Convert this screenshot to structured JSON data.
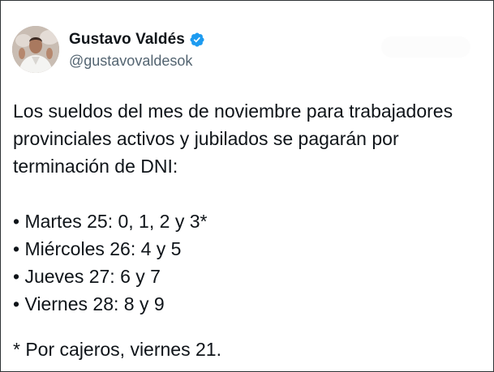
{
  "author": {
    "display_name": "Gustavo Valdés",
    "handle": "@gustavovaldesok",
    "avatar_icon": "user-avatar-photo",
    "verified_icon": "verified-badge-icon",
    "verified_color": "#1d9bf0"
  },
  "tweet": {
    "intro_lines": [
      "Los sueldos del mes de noviembre para trabajadores",
      "provinciales activos y jubilados se pagarán por",
      "terminación de DNI:"
    ],
    "schedule": [
      "• Martes 25: 0, 1, 2 y 3*",
      "• Miércoles 26: 4 y 5",
      "• Jueves 27: 6 y 7",
      "• Viernes 28: 8 y 9"
    ],
    "footnote": "* Por cajeros, viernes 21."
  }
}
